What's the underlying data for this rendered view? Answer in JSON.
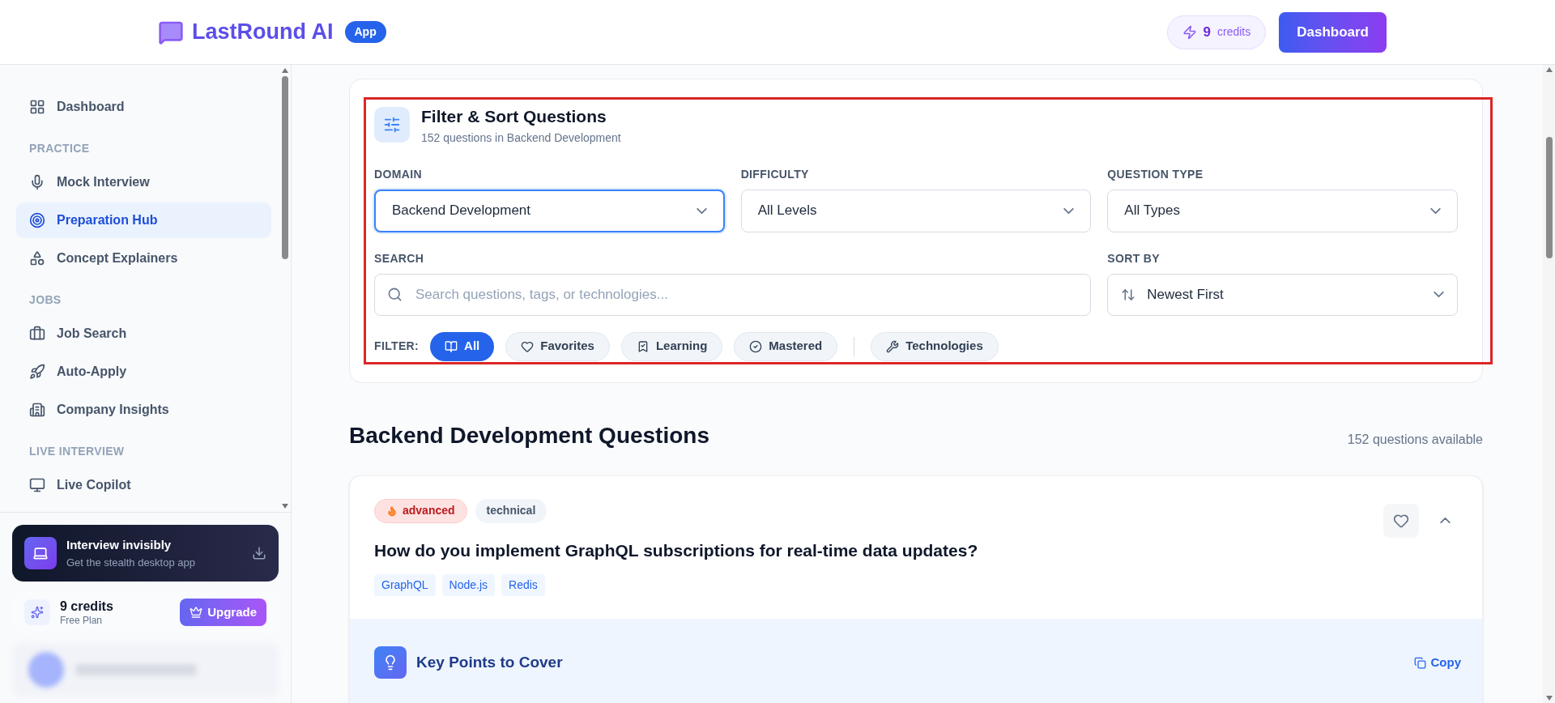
{
  "header": {
    "logo": "LastRound AI",
    "logo_badge": "App",
    "credits_count": "9",
    "credits_label": "credits",
    "dashboard_button": "Dashboard"
  },
  "sidebar": {
    "sections": [
      {
        "items": [
          {
            "label": "Dashboard",
            "selected": false
          }
        ]
      },
      {
        "title": "PRACTICE",
        "items": [
          {
            "label": "Mock Interview",
            "selected": false
          },
          {
            "label": "Preparation Hub",
            "selected": true
          },
          {
            "label": "Concept Explainers",
            "selected": false
          }
        ]
      },
      {
        "title": "JOBS",
        "items": [
          {
            "label": "Job Search",
            "selected": false
          },
          {
            "label": "Auto-Apply",
            "selected": false
          },
          {
            "label": "Company Insights",
            "selected": false
          }
        ]
      },
      {
        "title": "LIVE INTERVIEW",
        "items": [
          {
            "label": "Live Copilot",
            "selected": false
          }
        ]
      }
    ],
    "promo": {
      "title": "Interview invisibly",
      "subtitle": "Get the stealth desktop app"
    },
    "plan": {
      "credits": "9 credits",
      "plan": "Free Plan",
      "button": "Upgrade"
    }
  },
  "filter_panel": {
    "title": "Filter & Sort Questions",
    "subtitle": "152 questions in Backend Development",
    "selects": [
      {
        "label": "DOMAIN",
        "value": "Backend Development",
        "focused": true
      },
      {
        "label": "DIFFICULTY",
        "value": "All Levels",
        "focused": false
      },
      {
        "label": "QUESTION TYPE",
        "value": "All Types",
        "focused": false
      }
    ],
    "search": {
      "label": "SEARCH",
      "placeholder": "Search questions, tags, or technologies..."
    },
    "sort": {
      "label": "SORT BY",
      "value": "Newest First"
    },
    "filter_label": "FILTER:",
    "chips": [
      {
        "label": "All",
        "selected": true
      },
      {
        "label": "Favorites",
        "selected": false
      },
      {
        "label": "Learning",
        "selected": false
      },
      {
        "label": "Mastered",
        "selected": false
      },
      {
        "label": "Technologies",
        "selected": false
      }
    ]
  },
  "questions": {
    "heading": "Backend Development Questions",
    "count": "152 questions available",
    "items": [
      {
        "difficulty": "advanced",
        "type": "technical",
        "question": "How do you implement GraphQL subscriptions for real-time data updates?",
        "tags": [
          "GraphQL",
          "Node.js",
          "Redis"
        ],
        "favorite": false,
        "expanded": true,
        "key_points_title": "Key Points to Cover",
        "copy": "Copy"
      }
    ]
  }
}
